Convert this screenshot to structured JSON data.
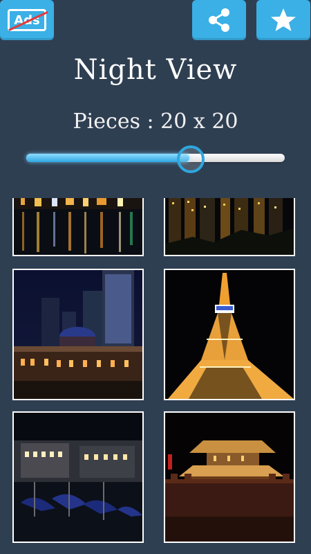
{
  "header": {
    "ads_label": "Ads",
    "share_icon": "share-icon",
    "favorite_icon": "star-icon"
  },
  "title": "Night View",
  "pieces": {
    "label": "Pieces : 20 x 20",
    "slider_level": 0.63
  },
  "colors": {
    "background": "#2f3f52",
    "accent": "#3ab0e6",
    "ads_slash": "#e23b3b"
  },
  "tiles": [
    {
      "subject": "city-harbor-night"
    },
    {
      "subject": "skyscrapers-night"
    },
    {
      "subject": "station-building-night"
    },
    {
      "subject": "tower-night"
    },
    {
      "subject": "canal-gondolas-night"
    },
    {
      "subject": "city-wall-gate-night"
    }
  ]
}
